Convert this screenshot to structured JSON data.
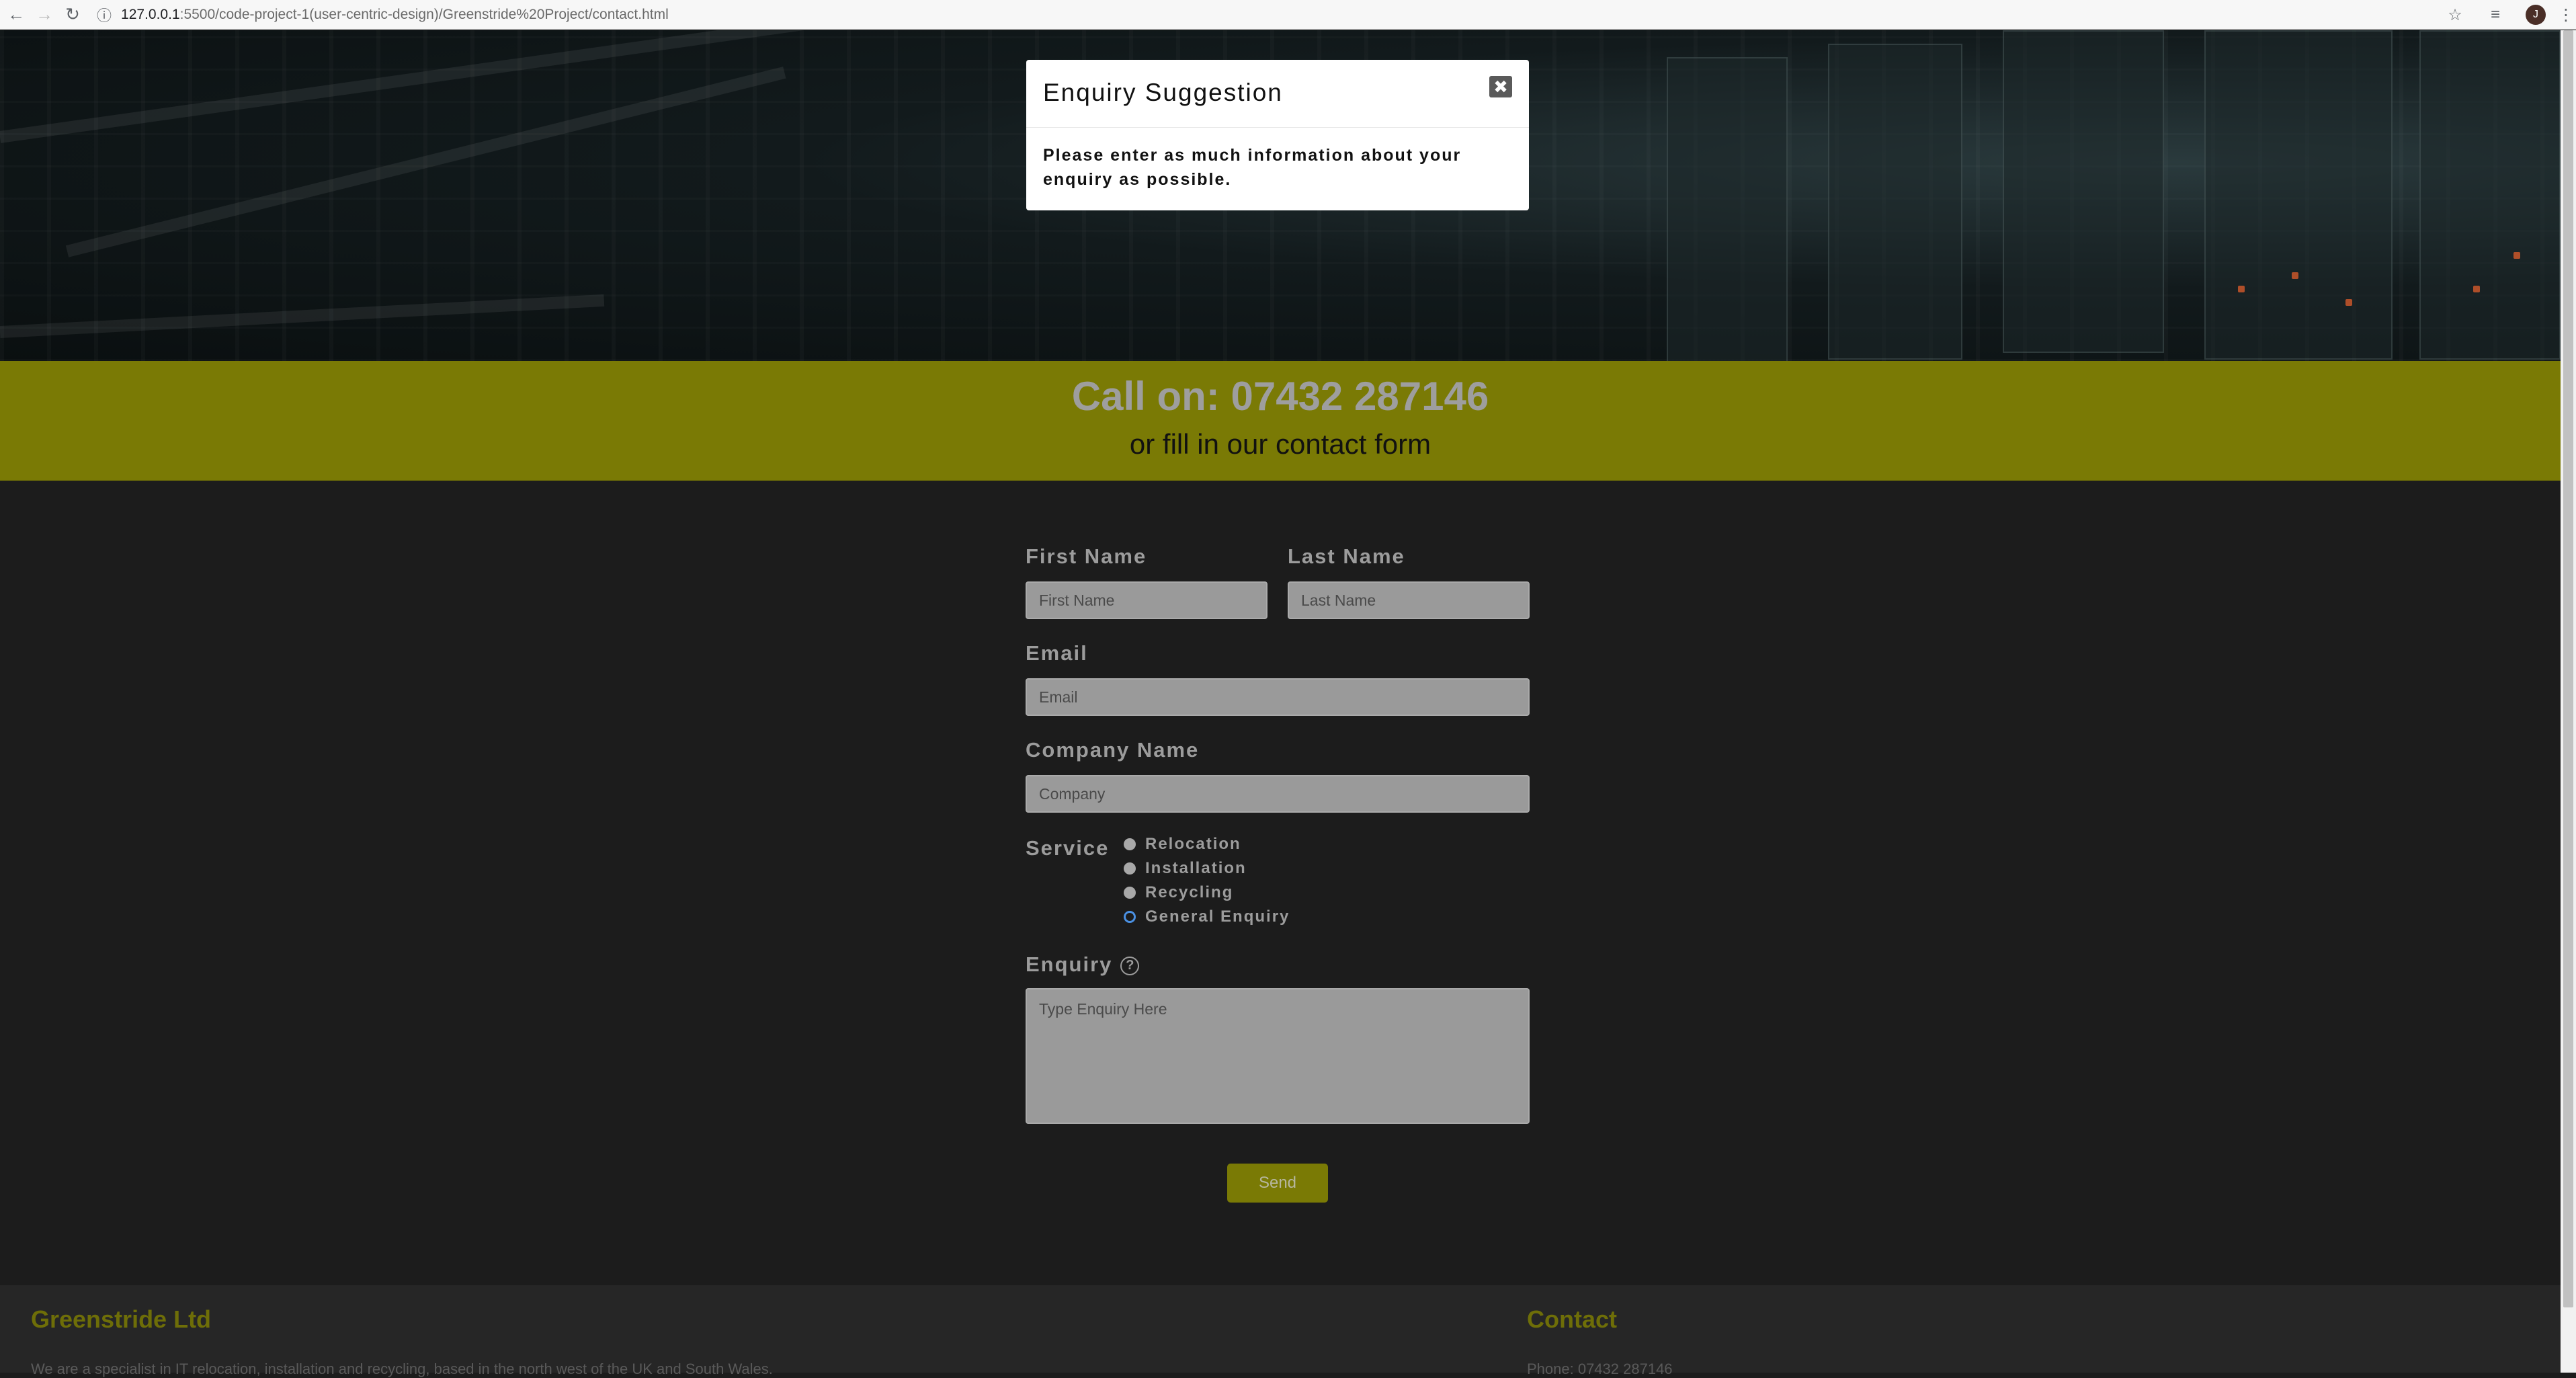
{
  "browser": {
    "url_host": "127.0.0.1",
    "url_path": ":5500/code-project-1(user-centric-design)/Greenstride%20Project/contact.html",
    "avatar_initial": "J"
  },
  "callbar": {
    "title": "Call on: 07432 287146",
    "subtitle": "or fill in our contact form"
  },
  "form": {
    "first_name_label": "First Name",
    "first_name_placeholder": "First Name",
    "last_name_label": "Last Name",
    "last_name_placeholder": "Last Name",
    "email_label": "Email",
    "email_placeholder": "Email",
    "company_label": "Company Name",
    "company_placeholder": "Company",
    "service_label": "Service",
    "services": [
      "Relocation",
      "Installation",
      "Recycling",
      "General Enquiry"
    ],
    "selected_service": "General Enquiry",
    "enquiry_label": "Enquiry",
    "help_glyph": "?",
    "enquiry_placeholder": "Type Enquiry Here",
    "send_label": "Send"
  },
  "footer": {
    "company": "Greenstride Ltd",
    "company_text": "We are a specialist in IT relocation, installation and recycling, based in the north west of the UK and South Wales.",
    "contact_title": "Contact",
    "contact_text": "Phone: 07432 287146"
  },
  "modal": {
    "title": "Enquiry Suggestion",
    "close_glyph": "✖",
    "body": "Please enter as much information about your enquiry as possible."
  },
  "colors": {
    "brand": "#7a7a05",
    "background": "#1c1c1c",
    "footer": "#262626"
  }
}
